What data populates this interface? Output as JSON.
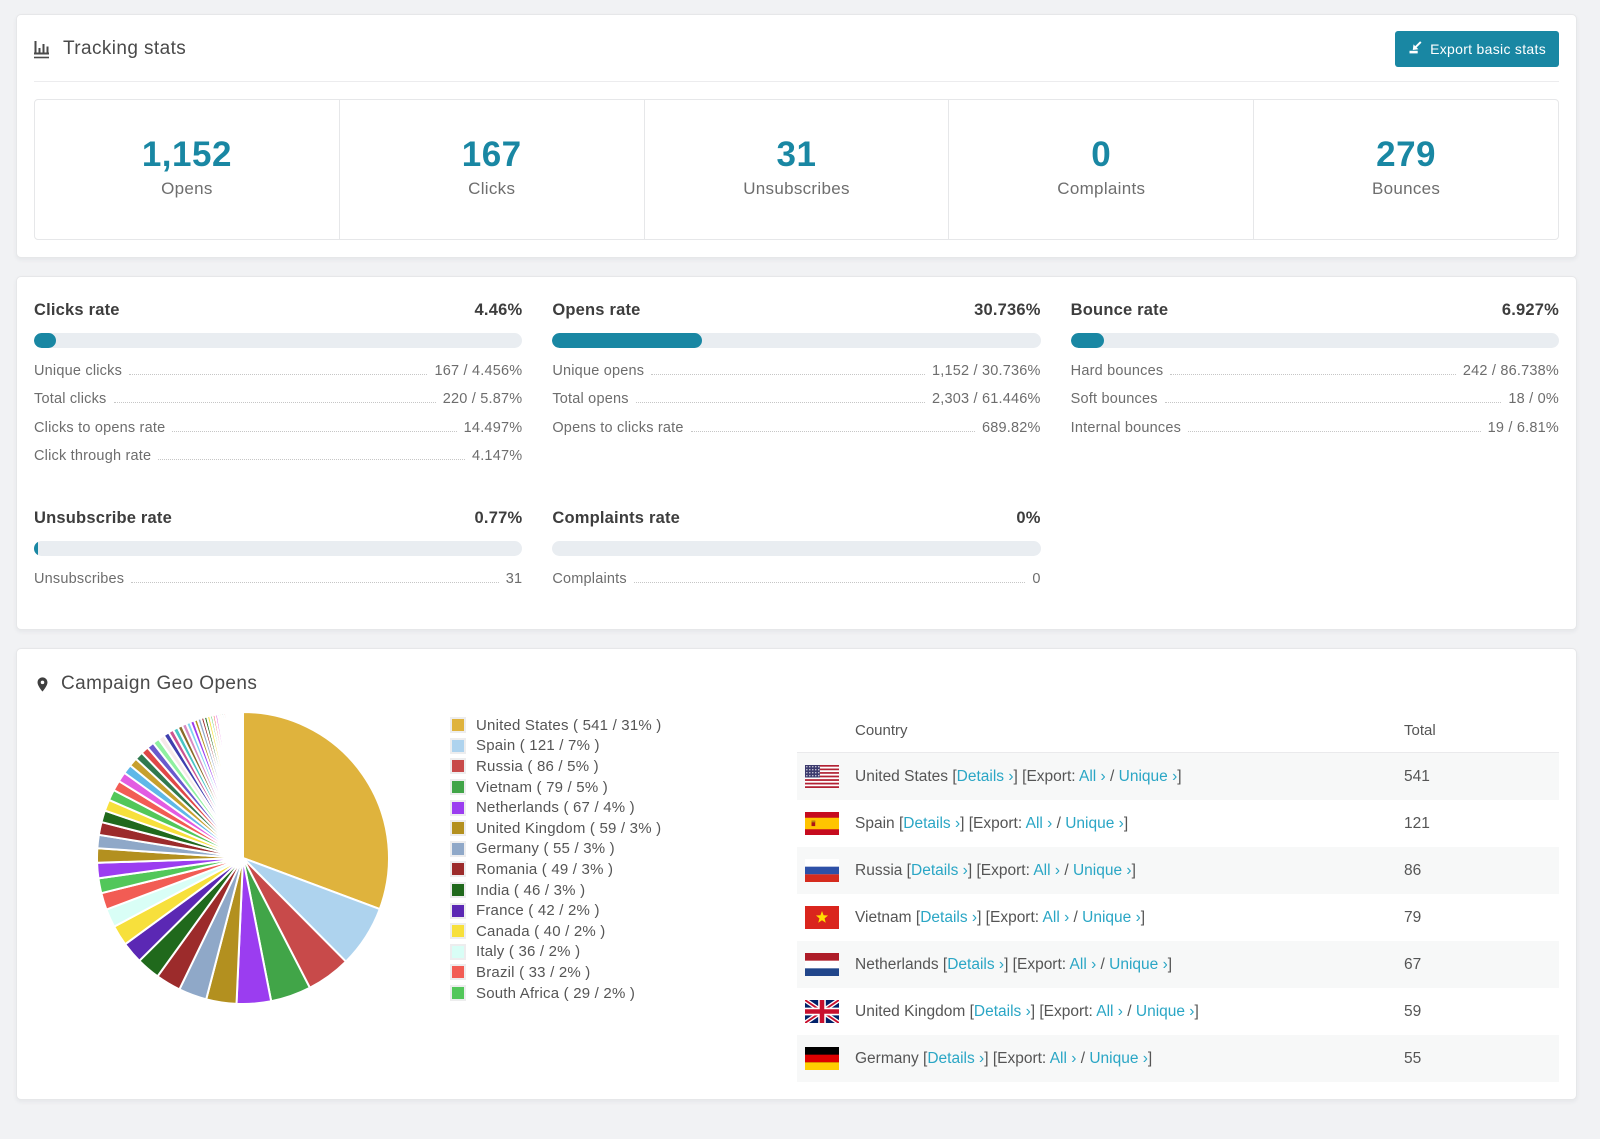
{
  "colors": {
    "accent": "#1987a3",
    "link": "#2aa6c5",
    "track": "#e9edf1"
  },
  "tracking": {
    "title": "Tracking stats",
    "export_button": "Export basic stats",
    "stats": [
      {
        "value": "1,152",
        "label": "Opens"
      },
      {
        "value": "167",
        "label": "Clicks"
      },
      {
        "value": "31",
        "label": "Unsubscribes"
      },
      {
        "value": "0",
        "label": "Complaints"
      },
      {
        "value": "279",
        "label": "Bounces"
      }
    ]
  },
  "rates": {
    "blocks": [
      {
        "title": "Clicks rate",
        "value": "4.46%",
        "percent": 4.46,
        "rows": [
          [
            "Unique clicks",
            "167 / 4.456%"
          ],
          [
            "Total clicks",
            "220 / 5.87%"
          ],
          [
            "Clicks to opens rate",
            "14.497%"
          ],
          [
            "Click through rate",
            "4.147%"
          ]
        ]
      },
      {
        "title": "Opens rate",
        "value": "30.736%",
        "percent": 30.736,
        "rows": [
          [
            "Unique opens",
            "1,152 / 30.736%"
          ],
          [
            "Total opens",
            "2,303 / 61.446%"
          ],
          [
            "Opens to clicks rate",
            "689.82%"
          ]
        ]
      },
      {
        "title": "Bounce rate",
        "value": "6.927%",
        "percent": 6.927,
        "rows": [
          [
            "Hard bounces",
            "242 / 86.738%"
          ],
          [
            "Soft bounces",
            "18 / 0%"
          ],
          [
            "Internal bounces",
            "19 / 6.81%"
          ]
        ]
      },
      {
        "title": "Unsubscribe rate",
        "value": "0.77%",
        "percent": 0.77,
        "rows": [
          [
            "Unsubscribes",
            "31"
          ]
        ]
      },
      {
        "title": "Complaints rate",
        "value": "0%",
        "percent": 0,
        "rows": [
          [
            "Complaints",
            "0"
          ]
        ]
      }
    ]
  },
  "geo": {
    "title": "Campaign Geo Opens",
    "table": {
      "columns": [
        "Country",
        "Total"
      ],
      "links": {
        "bo": "[",
        "bc": "]",
        "details": "Details ›",
        "export_prefix": "Export: ",
        "all": "All ›",
        "slash": " / ",
        "unique": "Unique ›"
      },
      "rows": [
        {
          "country": "United States",
          "flag": "us",
          "total": "541"
        },
        {
          "country": "Spain",
          "flag": "es",
          "total": "121"
        },
        {
          "country": "Russia",
          "flag": "ru",
          "total": "86"
        },
        {
          "country": "Vietnam",
          "flag": "vn",
          "total": "79"
        },
        {
          "country": "Netherlands",
          "flag": "nl",
          "total": "67"
        },
        {
          "country": "United Kingdom",
          "flag": "gb",
          "total": "59"
        },
        {
          "country": "Germany",
          "flag": "de",
          "total": "55"
        }
      ]
    }
  },
  "chart_data": {
    "type": "pie",
    "title": "Campaign Geo Opens",
    "categories": [
      "United States",
      "Spain",
      "Russia",
      "Vietnam",
      "Netherlands",
      "United Kingdom",
      "Germany",
      "Romania",
      "India",
      "France",
      "Canada",
      "Italy",
      "Brazil",
      "South Africa"
    ],
    "values": [
      541,
      121,
      86,
      79,
      67,
      59,
      55,
      49,
      46,
      42,
      40,
      36,
      33,
      29
    ],
    "percent_labels": [
      "31%",
      "7%",
      "5%",
      "5%",
      "4%",
      "3%",
      "3%",
      "3%",
      "3%",
      "2%",
      "2%",
      "2%",
      "2%",
      "2%"
    ],
    "colors": [
      "#dfb33d",
      "#aed3ee",
      "#c84a4a",
      "#41a548",
      "#9b3df0",
      "#b3901f",
      "#8fa8c8",
      "#9c2b2b",
      "#20691c",
      "#5b28b4",
      "#f7e03c",
      "#d9fef6",
      "#f25c54",
      "#52c75a"
    ],
    "legend": [
      "United States ( 541 / 31% )",
      "Spain ( 121 / 7% )",
      "Russia ( 86 / 5% )",
      "Vietnam ( 79 / 5% )",
      "Netherlands ( 67 / 4% )",
      "United Kingdom ( 59 / 3% )",
      "Germany ( 55 / 3% )",
      "Romania ( 49 / 3% )",
      "India ( 46 / 3% )",
      "France ( 42 / 2% )",
      "Canada ( 40 / 2% )",
      "Italy ( 36 / 2% )",
      "Brazil ( 33 / 2% )",
      "South Africa ( 29 / 2% )"
    ],
    "others_values": [
      30,
      28,
      26,
      25,
      23,
      22,
      21,
      20,
      19,
      18,
      17,
      16,
      15,
      14,
      13,
      12,
      11,
      10,
      10,
      9,
      9,
      8,
      8,
      7,
      7,
      6,
      6,
      6,
      5,
      5,
      5,
      4,
      4,
      4,
      4,
      3,
      3,
      3,
      3,
      3,
      2,
      2,
      2,
      2,
      2,
      2,
      1,
      1,
      1,
      1,
      1,
      1
    ],
    "others_palette": [
      "#9b3df0",
      "#b3901f",
      "#8fa8c8",
      "#9c2b2b",
      "#20691c",
      "#f7e03c",
      "#52c75a",
      "#f25c54",
      "#e25ce2",
      "#5fb8e8",
      "#c7a02e",
      "#317a4f",
      "#e04848",
      "#6a5acd",
      "#8ff0a0",
      "#f6e9e9",
      "#3f3fae",
      "#cc5490",
      "#49c5c5",
      "#8a6b2a",
      "#d98cc3",
      "#7fd4f0"
    ],
    "legend_position": "right",
    "start_angle_deg": -90,
    "direction": "clockwise"
  }
}
